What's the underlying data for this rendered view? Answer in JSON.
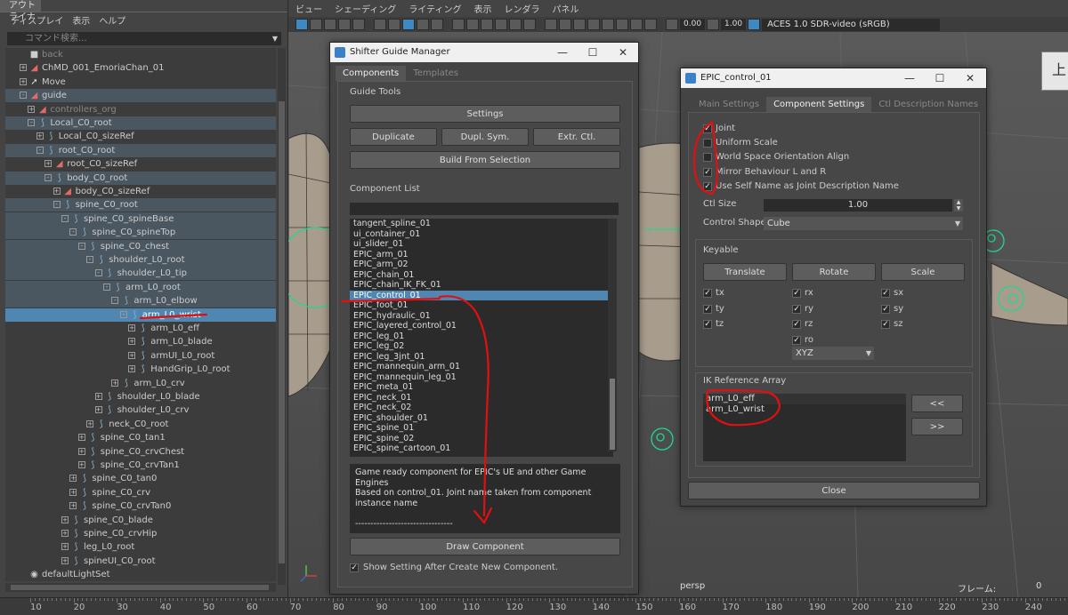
{
  "outliner": {
    "title": "アウトライナ",
    "menu": [
      "ディスプレイ",
      "表示",
      "ヘルプ"
    ],
    "search_placeholder": "コマンド検索...",
    "tree": [
      {
        "label": "back",
        "indent": 0,
        "icon": "camera",
        "exp": "",
        "state": "dim"
      },
      {
        "label": "ChMD_001_EmoriaChan_01",
        "indent": 0,
        "icon": "mesh",
        "exp": "+",
        "state": ""
      },
      {
        "label": "Move",
        "indent": 0,
        "icon": "move",
        "exp": "+",
        "state": ""
      },
      {
        "label": "guide",
        "indent": 0,
        "icon": "mesh",
        "exp": "-",
        "state": "grp"
      },
      {
        "label": "controllers_org",
        "indent": 1,
        "icon": "mesh",
        "exp": "+",
        "state": "dim"
      },
      {
        "label": "Local_C0_root",
        "indent": 1,
        "icon": "joint",
        "exp": "-",
        "state": "grp"
      },
      {
        "label": "Local_C0_sizeRef",
        "indent": 2,
        "icon": "joint",
        "exp": "+",
        "state": ""
      },
      {
        "label": "root_C0_root",
        "indent": 2,
        "icon": "joint",
        "exp": "-",
        "state": "grp"
      },
      {
        "label": "root_C0_sizeRef",
        "indent": 3,
        "icon": "mesh",
        "exp": "+",
        "state": ""
      },
      {
        "label": "body_C0_root",
        "indent": 3,
        "icon": "joint",
        "exp": "-",
        "state": "grp"
      },
      {
        "label": "body_C0_sizeRef",
        "indent": 4,
        "icon": "mesh",
        "exp": "+",
        "state": ""
      },
      {
        "label": "spine_C0_root",
        "indent": 4,
        "icon": "joint",
        "exp": "-",
        "state": "grp"
      },
      {
        "label": "spine_C0_spineBase",
        "indent": 5,
        "icon": "joint",
        "exp": "-",
        "state": "grp"
      },
      {
        "label": "spine_C0_spineTop",
        "indent": 6,
        "icon": "joint",
        "exp": "-",
        "state": "grp"
      },
      {
        "label": "spine_C0_chest",
        "indent": 7,
        "icon": "joint",
        "exp": "-",
        "state": "grp"
      },
      {
        "label": "shoulder_L0_root",
        "indent": 8,
        "icon": "joint",
        "exp": "-",
        "state": "grp"
      },
      {
        "label": "shoulder_L0_tip",
        "indent": 9,
        "icon": "joint",
        "exp": "-",
        "state": "grp"
      },
      {
        "label": "arm_L0_root",
        "indent": 10,
        "icon": "joint",
        "exp": "-",
        "state": "grp"
      },
      {
        "label": "arm_L0_elbow",
        "indent": 11,
        "icon": "joint",
        "exp": "-",
        "state": "grp"
      },
      {
        "label": "arm_L0_wrist",
        "indent": 12,
        "icon": "joint",
        "exp": "-",
        "state": "sel"
      },
      {
        "label": "arm_L0_eff",
        "indent": 13,
        "icon": "joint",
        "exp": "+",
        "state": ""
      },
      {
        "label": "arm_L0_blade",
        "indent": 13,
        "icon": "joint",
        "exp": "+",
        "state": ""
      },
      {
        "label": "armUI_L0_root",
        "indent": 13,
        "icon": "joint",
        "exp": "+",
        "state": ""
      },
      {
        "label": "HandGrip_L0_root",
        "indent": 13,
        "icon": "joint",
        "exp": "+",
        "state": ""
      },
      {
        "label": "arm_L0_crv",
        "indent": 11,
        "icon": "joint",
        "exp": "+",
        "state": ""
      },
      {
        "label": "shoulder_L0_blade",
        "indent": 9,
        "icon": "joint",
        "exp": "+",
        "state": ""
      },
      {
        "label": "shoulder_L0_crv",
        "indent": 9,
        "icon": "joint",
        "exp": "+",
        "state": ""
      },
      {
        "label": "neck_C0_root",
        "indent": 8,
        "icon": "joint",
        "exp": "+",
        "state": ""
      },
      {
        "label": "spine_C0_tan1",
        "indent": 7,
        "icon": "joint",
        "exp": "+",
        "state": ""
      },
      {
        "label": "spine_C0_crvChest",
        "indent": 7,
        "icon": "joint",
        "exp": "+",
        "state": ""
      },
      {
        "label": "spine_C0_crvTan1",
        "indent": 7,
        "icon": "joint",
        "exp": "+",
        "state": ""
      },
      {
        "label": "spine_C0_tan0",
        "indent": 6,
        "icon": "joint",
        "exp": "+",
        "state": ""
      },
      {
        "label": "spine_C0_crv",
        "indent": 6,
        "icon": "joint",
        "exp": "+",
        "state": ""
      },
      {
        "label": "spine_C0_crvTan0",
        "indent": 6,
        "icon": "joint",
        "exp": "+",
        "state": ""
      },
      {
        "label": "spine_C0_blade",
        "indent": 5,
        "icon": "joint",
        "exp": "+",
        "state": ""
      },
      {
        "label": "spine_C0_crvHip",
        "indent": 5,
        "icon": "joint",
        "exp": "+",
        "state": ""
      },
      {
        "label": "leg_L0_root",
        "indent": 5,
        "icon": "joint",
        "exp": "+",
        "state": ""
      },
      {
        "label": "spineUI_C0_root",
        "indent": 5,
        "icon": "joint",
        "exp": "+",
        "state": ""
      },
      {
        "label": "defaultLightSet",
        "indent": 0,
        "icon": "light",
        "exp": "",
        "state": ""
      }
    ]
  },
  "viewport": {
    "menu": [
      "ビュー",
      "シェーディング",
      "ライティング",
      "表示",
      "レンダラ",
      "パネル"
    ],
    "value_a": "0.00",
    "value_b": "1.00",
    "color_space": "ACES 1.0 SDR-video (sRGB)",
    "camera": "persp",
    "frame_label": "フレーム:",
    "frame_value": "0",
    "navcube_label": "上"
  },
  "ruler": {
    "labels": [
      "10",
      "20",
      "30",
      "40",
      "50",
      "60",
      "70",
      "80",
      "90",
      "100",
      "110",
      "120",
      "130",
      "140",
      "150",
      "160",
      "170",
      "180",
      "190",
      "200",
      "210",
      "220",
      "230",
      "240"
    ]
  },
  "sgm": {
    "title": "Shifter Guide Manager",
    "tabs": [
      "Components",
      "Templates"
    ],
    "guide_tools_label": "Guide Tools",
    "settings_btn": "Settings",
    "duplicate_btn": "Duplicate",
    "dupl_sym_btn": "Dupl. Sym.",
    "extr_ctl_btn": "Extr. Ctl.",
    "build_btn": "Build From Selection",
    "component_list_label": "Component List",
    "components": [
      "tangent_spline_01",
      "ui_container_01",
      "ui_slider_01",
      "EPIC_arm_01",
      "EPIC_arm_02",
      "EPIC_chain_01",
      "EPIC_chain_IK_FK_01",
      "EPIC_control_01",
      "EPIC_foot_01",
      "EPIC_hydraulic_01",
      "EPIC_layered_control_01",
      "EPIC_leg_01",
      "EPIC_leg_02",
      "EPIC_leg_3jnt_01",
      "EPIC_mannequin_arm_01",
      "EPIC_mannequin_leg_01",
      "EPIC_meta_01",
      "EPIC_neck_01",
      "EPIC_neck_02",
      "EPIC_shoulder_01",
      "EPIC_spine_01",
      "EPIC_spine_02",
      "EPIC_spine_cartoon_01"
    ],
    "selected_index": 7,
    "description": [
      "Game ready component for EPIC's UE and other Game Engines",
      "Based on control_01. Joint name taken from component",
      "instance name",
      "",
      "--------------------------------"
    ],
    "draw_btn": "Draw Component",
    "show_setting_label": "Show Setting After Create New Component."
  },
  "epic": {
    "title": "EPIC_control_01",
    "tabs": [
      "Main Settings",
      "Component Settings",
      "Ctl Description Names"
    ],
    "options": [
      {
        "label": "Joint",
        "checked": true
      },
      {
        "label": "Uniform Scale",
        "checked": false
      },
      {
        "label": "World Space Orientation Align",
        "checked": false
      },
      {
        "label": "Mirror Behaviour L and R",
        "checked": true
      },
      {
        "label": "Use Self Name as Joint Description Name",
        "checked": true
      }
    ],
    "ctl_size_label": "Ctl Size",
    "ctl_size_value": "1.00",
    "ctl_shape_label": "Control Shape",
    "ctl_shape_value": "Cube",
    "keyable_label": "Keyable",
    "translate_btn": "Translate",
    "rotate_btn": "Rotate",
    "scale_btn": "Scale",
    "translate_ch": [
      "tx",
      "ty",
      "tz"
    ],
    "rotate_ch": [
      "rx",
      "ry",
      "rz",
      "ro"
    ],
    "scale_ch": [
      "sx",
      "sy",
      "sz"
    ],
    "rot_order": "XYZ",
    "ik_label": "IK Reference Array",
    "ik_items": [
      "arm_L0_eff",
      "arm_L0_wrist"
    ],
    "add_btn": "<<",
    "remove_btn": ">>",
    "close_btn": "Close"
  },
  "colors": {
    "selection": "#4f87b2",
    "annotation": "#e01010",
    "joint_green": "#20d890"
  }
}
